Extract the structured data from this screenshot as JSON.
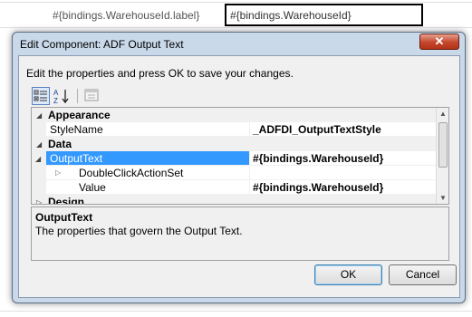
{
  "background": {
    "label_cell": "#{bindings.WarehouseId.label}",
    "value_cell": "#{bindings.WarehouseId}"
  },
  "dialog": {
    "title": "Edit Component: ADF Output Text",
    "close_glyph": "✕",
    "instructions": "Edit the properties and press OK to save your changes.",
    "toolbar": {
      "categorized_icon": "categorized-view-icon",
      "alphabetical_icon": "sort-alphabetical-icon",
      "property_pages_icon": "property-pages-icon"
    },
    "grid": {
      "categories": [
        {
          "name": "Appearance"
        },
        {
          "name": "Data"
        },
        {
          "name": "Design"
        }
      ],
      "properties": [
        {
          "name": "StyleName",
          "value": "_ADFDI_OutputTextStyle"
        },
        {
          "name": "OutputText",
          "value": "#{bindings.WarehouseId}",
          "selected": true
        },
        {
          "name": "DoubleClickActionSet",
          "value": ""
        },
        {
          "name": "Value",
          "value": "#{bindings.WarehouseId}"
        }
      ]
    },
    "description": {
      "title": "OutputText",
      "text": "The properties that govern the Output Text."
    },
    "buttons": {
      "ok": "OK",
      "cancel": "Cancel"
    }
  }
}
